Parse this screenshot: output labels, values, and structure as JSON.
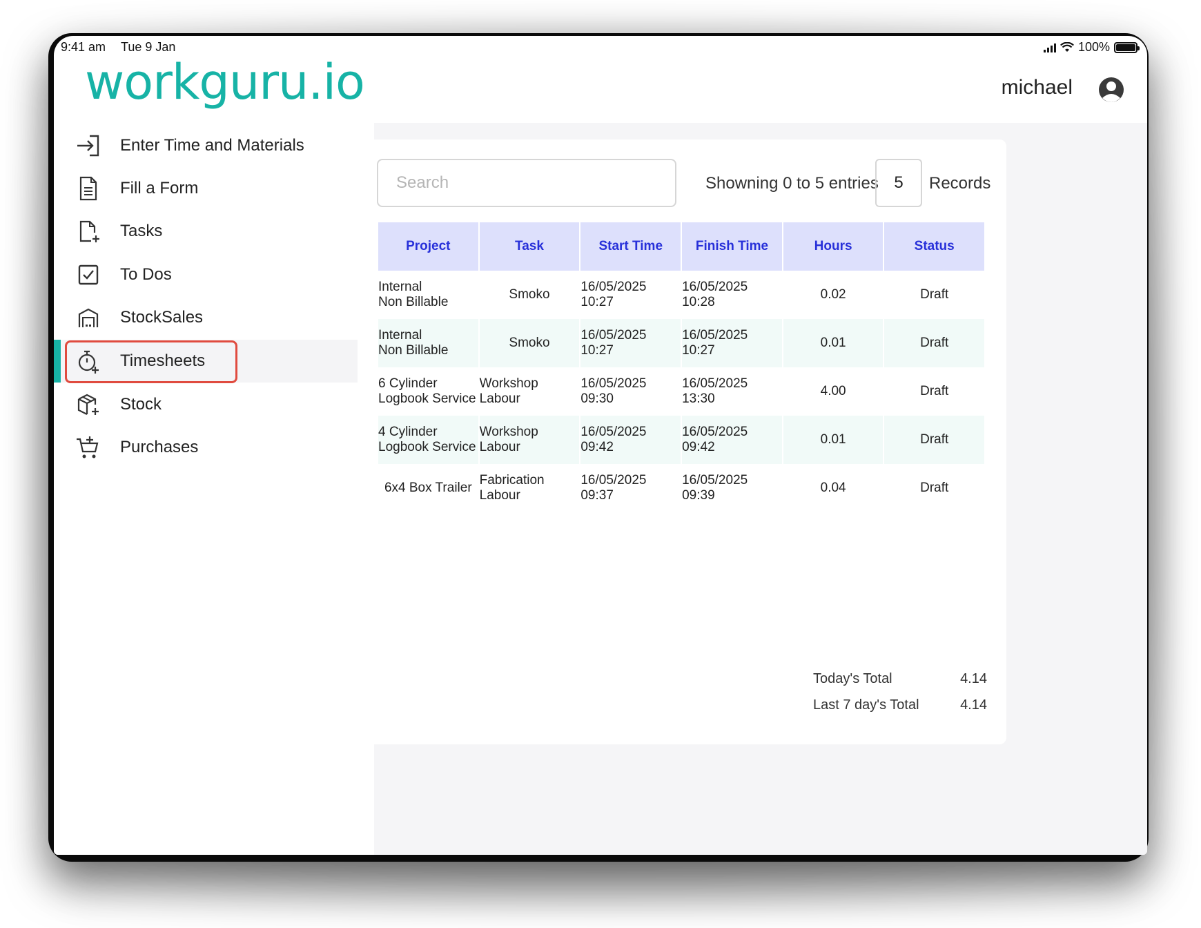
{
  "status_bar": {
    "time": "9:41 am",
    "date": "Tue 9 Jan",
    "battery": "100%"
  },
  "header": {
    "logo": "workguru.io",
    "user_name": "michael"
  },
  "sidebar": {
    "items": [
      {
        "label": "Enter Time and Materials",
        "icon": "sign-in-icon"
      },
      {
        "label": "Fill a Form",
        "icon": "form-document-icon"
      },
      {
        "label": "Tasks",
        "icon": "task-add-icon"
      },
      {
        "label": "To Dos",
        "icon": "checkbox-icon"
      },
      {
        "label": "StockSales",
        "icon": "warehouse-icon"
      },
      {
        "label": "Timesheets",
        "icon": "stopwatch-icon",
        "active": true
      },
      {
        "label": "Stock",
        "icon": "box-add-icon"
      },
      {
        "label": "Purchases",
        "icon": "cart-add-icon"
      }
    ]
  },
  "toolbar": {
    "search_placeholder": "Search",
    "showing_text": "Showning 0 to 5 entries",
    "records_count": "5",
    "records_label": "Records"
  },
  "table": {
    "headers": [
      "Project",
      "Task",
      "Start Time",
      "Finish Time",
      "Hours",
      "Status"
    ],
    "rows": [
      {
        "project1": "Internal",
        "project2": "Non Billable",
        "task1": "Smoko",
        "task2": "",
        "start1": "16/05/2025",
        "start2": "10:27",
        "finish1": "16/05/2025",
        "finish2": "10:28",
        "hours": "0.02",
        "status": "Draft"
      },
      {
        "project1": "Internal",
        "project2": "Non Billable",
        "task1": "Smoko",
        "task2": "",
        "start1": "16/05/2025",
        "start2": "10:27",
        "finish1": "16/05/2025",
        "finish2": "10:27",
        "hours": "0.01",
        "status": "Draft"
      },
      {
        "project1": "6 Cylinder",
        "project2": "Logbook Service",
        "task1": "Workshop",
        "task2": "Labour",
        "start1": "16/05/2025",
        "start2": "09:30",
        "finish1": "16/05/2025",
        "finish2": "13:30",
        "hours": "4.00",
        "status": "Draft"
      },
      {
        "project1": "4 Cylinder",
        "project2": "Logbook Service",
        "task1": "Workshop",
        "task2": "Labour",
        "start1": "16/05/2025",
        "start2": "09:42",
        "finish1": "16/05/2025",
        "finish2": "09:42",
        "hours": "0.01",
        "status": "Draft"
      },
      {
        "project1": "6x4 Box Trailer",
        "project2": "",
        "task1": "Fabrication",
        "task2": "Labour",
        "start1": "16/05/2025",
        "start2": "09:37",
        "finish1": "16/05/2025",
        "finish2": "09:39",
        "hours": "0.04",
        "status": "Draft"
      }
    ]
  },
  "totals": {
    "today_label": "Today's Total",
    "today_value": "4.14",
    "week_label": "Last 7 day's Total",
    "week_value": "4.14"
  },
  "colors": {
    "brand": "#17b3a6",
    "header_bg": "#dde0fc",
    "header_text": "#2730d9",
    "highlight": "#e04b3f",
    "alt_row": "#f1faf8"
  }
}
